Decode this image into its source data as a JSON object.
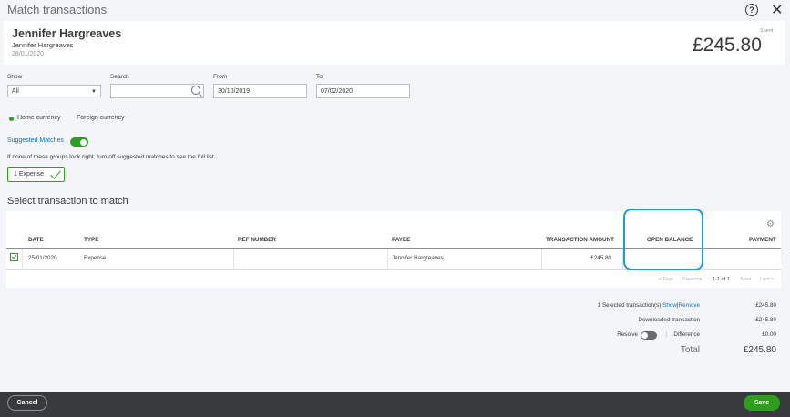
{
  "dialog": {
    "title": "Match transactions",
    "help_icon": "?",
    "close_icon": "✕"
  },
  "payee": {
    "name": "Jennifer Hargreaves",
    "sub_name": "Jennifer Hargreaves",
    "date": "28/01/2020",
    "spent_label": "Spent",
    "amount": "£245.80"
  },
  "filters": {
    "show_label": "Show",
    "show_value": "All",
    "search_label": "Search",
    "search_value": "",
    "from_label": "From",
    "from_value": "30/10/2019",
    "to_label": "To",
    "to_value": "07/02/2020"
  },
  "currency": {
    "home": "Home currency",
    "foreign": "Foreign currency"
  },
  "suggested": {
    "label": "Suggested Matches",
    "hint": "If none of these groups look right, turn off suggested matches to see the full list.",
    "chip": "1 Expense"
  },
  "section_title": "Select transaction to match",
  "table": {
    "headers": [
      "DATE",
      "TYPE",
      "REF NUMBER",
      "PAYEE",
      "TRANSACTION AMOUNT",
      "OPEN BALANCE",
      "PAYMENT"
    ],
    "rows": [
      {
        "date": "25/01/2020",
        "type": "Expense",
        "ref": "",
        "payee": "Jennifer Hargreaves",
        "amount": "£245.80",
        "open_balance": "",
        "payment": ""
      }
    ],
    "pager": {
      "first": "< First",
      "previous": "Previous",
      "range": "1-1 of 1",
      "next": "Next",
      "last": "Last >"
    }
  },
  "totals": {
    "selected_label": "1 Selected transaction(s)",
    "show_link": "Show",
    "sep": "|",
    "remove_link": "Remove",
    "selected_value": "£245.80",
    "downloaded_label": "Downloaded transaction",
    "downloaded_value": "£245.80",
    "resolve_label": "Resolve",
    "divider": "|",
    "difference_label": "Difference",
    "difference_value": "£0.00",
    "total_label": "Total",
    "total_value": "£245.80"
  },
  "footer": {
    "cancel": "Cancel",
    "save": "Save"
  }
}
